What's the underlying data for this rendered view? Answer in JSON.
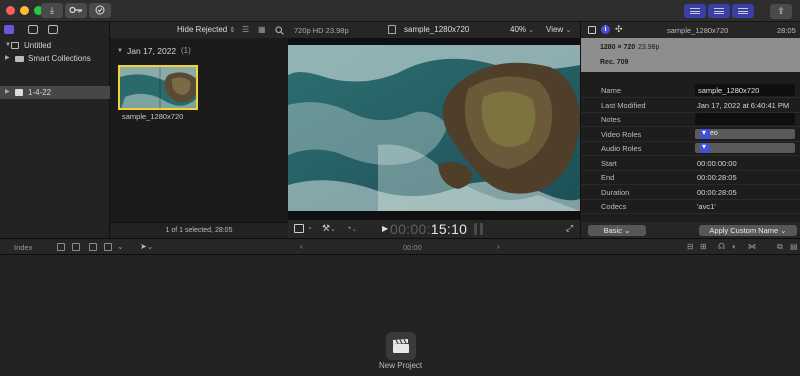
{
  "toolbar": {
    "import_icon": "download-arrow-icon",
    "keywords_icon": "key-icon",
    "background_tasks_icon": "checkmark-circle-icon",
    "share_icon": "share-icon"
  },
  "browser": {
    "filter_label": "Hide Rejected",
    "date_header": "Jan 17, 2022",
    "date_count": "(1)",
    "clip_name": "sample_1280x720",
    "footer_status": "1 of 1 selected, 28:05"
  },
  "library": {
    "items": [
      {
        "label": "Untitled"
      },
      {
        "label": "Smart Collections"
      },
      {
        "label": "1-4-22"
      }
    ]
  },
  "viewer": {
    "format": "720p HD 23.98p",
    "clip_title": "sample_1280x720",
    "zoom": "40%",
    "view_label": "View",
    "timecode_dim": "00:00:",
    "timecode_lit": "15:10"
  },
  "inspector": {
    "header_title": "sample_1280x720",
    "header_time": "28:05",
    "resolution": "1280 × 720",
    "frame_rate": "23.98p",
    "color_space": "Rec. 709",
    "rows": {
      "name_label": "Name",
      "name_value": "sample_1280x720",
      "modified_label": "Last Modified",
      "modified_value": "Jan 17, 2022 at 6:40:41 PM",
      "notes_label": "Notes",
      "notes_value": "",
      "video_roles_label": "Video Roles",
      "video_roles_value": "Video",
      "audio_roles_label": "Audio Roles",
      "audio_roles_value": "",
      "start_label": "Start",
      "start_value": "00:00:00:00",
      "end_label": "End",
      "end_value": "00:00:28:05",
      "duration_label": "Duration",
      "duration_value": "00:00:28:05",
      "codecs_label": "Codecs",
      "codecs_value": "'avc1'"
    },
    "metadata_view": "Basic",
    "apply_name": "Apply Custom Name"
  },
  "timeline": {
    "index_label": "Index",
    "timecode": "00:00",
    "new_project_label": "New Project"
  },
  "colors": {
    "accent": "#3f51d8",
    "selection": "#f1d335"
  }
}
